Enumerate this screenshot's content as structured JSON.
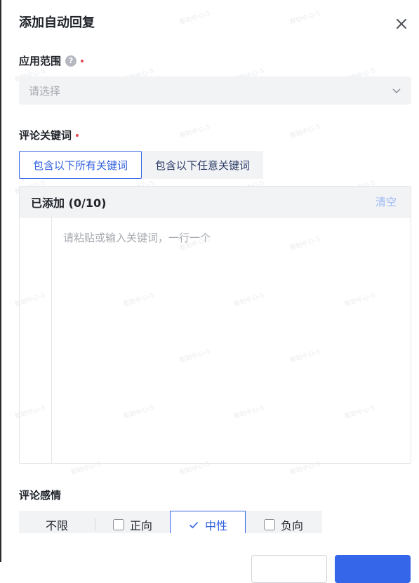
{
  "dialog": {
    "title": "添加自动回复",
    "close_icon": "close-icon"
  },
  "scope": {
    "label": "应用范围",
    "help_icon": "help-circle-icon",
    "help_glyph": "?",
    "placeholder": "请选择"
  },
  "keywords": {
    "label": "评论关键词",
    "match_modes": [
      "包含以下所有关键词",
      "包含以下任意关键词"
    ],
    "selected_mode": 0,
    "added_label": "已添加 (0/10)",
    "clear_label": "清空",
    "input_placeholder": "请粘贴或输入关键词，一行一个"
  },
  "sentiment": {
    "label": "评论感情",
    "options": [
      {
        "label": "不限",
        "checkbox": false,
        "checked": false
      },
      {
        "label": "正向",
        "checkbox": true,
        "checked": false
      },
      {
        "label": "中性",
        "checkbox": true,
        "checked": true
      },
      {
        "label": "负向",
        "checkbox": true,
        "checked": false
      }
    ]
  },
  "watermark_text": "帮助中心-5",
  "colors": {
    "primary": "#3565e8",
    "required_dot": "#e5484d",
    "field_bg": "#f2f3f5",
    "clear_link": "#9bb8f2"
  }
}
